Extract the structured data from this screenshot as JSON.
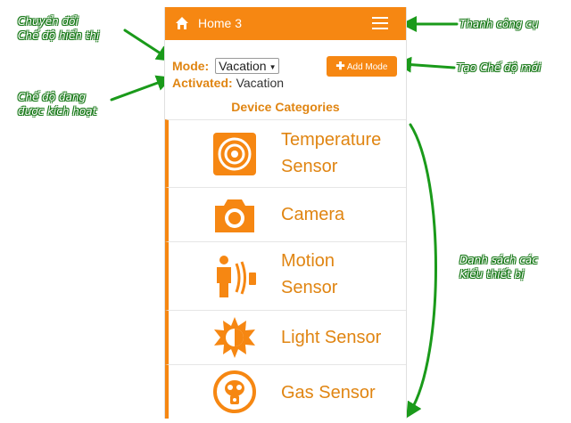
{
  "app": {
    "title": "Home 3"
  },
  "mode": {
    "label": "Mode:",
    "selected": "Vacation",
    "add_button_label": "Add Mode",
    "activated_label": "Activated:",
    "activated_value": "Vacation"
  },
  "categories": {
    "title": "Device Categories",
    "items": [
      {
        "line1": "Temperature",
        "line2": "Sensor",
        "icon": "temperature-icon"
      },
      {
        "line1": "Camera",
        "line2": "",
        "icon": "camera-icon"
      },
      {
        "line1": "Motion",
        "line2": "Sensor",
        "icon": "motion-icon"
      },
      {
        "line1": "Light Sensor",
        "line2": "",
        "icon": "light-icon"
      },
      {
        "line1": "Gas Sensor",
        "line2": "",
        "icon": "gas-icon"
      }
    ]
  },
  "annotations": {
    "switch_mode": [
      "Chuyển đổi",
      "Chế độ hiển thị"
    ],
    "activated_mode": [
      "Chế độ đang",
      "được kích hoạt"
    ],
    "toolbar": "Thanh công cụ",
    "new_mode": "Tạo Chế độ mới",
    "device_list": [
      "Danh sách các",
      "Kiểu thiết bị"
    ]
  },
  "colors": {
    "accent": "#f68712",
    "accent_text": "#e08512",
    "annotation": "#1a7a1a"
  }
}
